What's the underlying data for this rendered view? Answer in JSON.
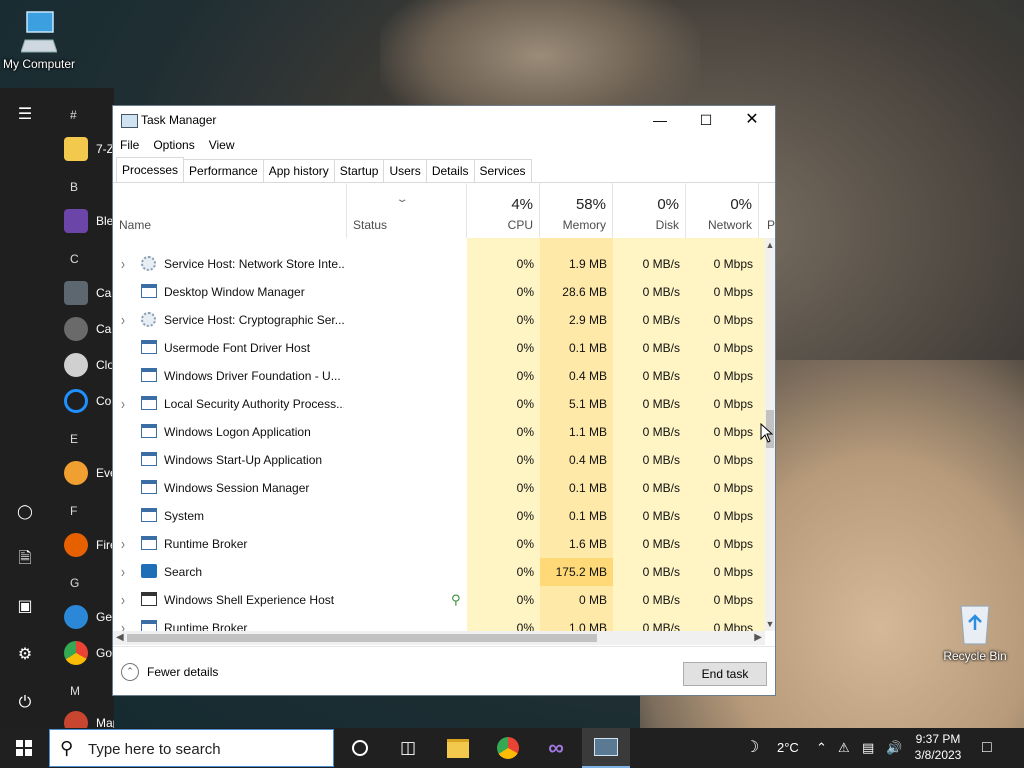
{
  "desktop": {
    "my_computer": "My Computer",
    "recycle_bin": "Recycle Bin"
  },
  "start_menu": {
    "letters": [
      "#",
      "B",
      "C",
      "E",
      "F",
      "G",
      "M"
    ],
    "apps": [
      {
        "label": "7-Z",
        "icon": "folder-icon",
        "color": "#f2c94c"
      },
      {
        "label": "Ble",
        "icon": "blend-icon",
        "color": "#6b45a8"
      },
      {
        "label": "Cal",
        "icon": "calculator-icon",
        "color": "#5c6770"
      },
      {
        "label": "Can",
        "icon": "camera-icon",
        "color": "#6a6a6a"
      },
      {
        "label": "Clo",
        "icon": "clock-icon",
        "color": "#d0d0d0"
      },
      {
        "label": "Co",
        "icon": "cortana-icon",
        "color": "#1e90ff"
      },
      {
        "label": "Eve",
        "icon": "search-tool-icon",
        "color": "#f0a030"
      },
      {
        "label": "Fire",
        "icon": "firefox-icon",
        "color": "#e66000"
      },
      {
        "label": "Ge",
        "icon": "help-icon",
        "color": "#2b88d8"
      },
      {
        "label": "Go",
        "icon": "chrome-icon",
        "color": "#34a853"
      },
      {
        "label": "Maps",
        "icon": "maps-icon",
        "color": "#c84630"
      }
    ]
  },
  "task_manager": {
    "title": "Task Manager",
    "menu": [
      "File",
      "Options",
      "View"
    ],
    "tabs": [
      "Processes",
      "Performance",
      "App history",
      "Startup",
      "Users",
      "Details",
      "Services"
    ],
    "columns": {
      "name": "Name",
      "status": "Status",
      "cpu_pct": "4%",
      "cpu": "CPU",
      "memory_pct": "58%",
      "memory": "Memory",
      "disk_pct": "0%",
      "disk": "Disk",
      "network_pct": "0%",
      "network": "Network",
      "power": "P"
    },
    "rows": [
      {
        "expand": true,
        "icon": "svc",
        "name": "Service Host: Network Store Inte...",
        "cpu": "0%",
        "memory": "1.9 MB",
        "disk": "0 MB/s",
        "network": "0 Mbps"
      },
      {
        "expand": false,
        "icon": "win",
        "name": "Desktop Window Manager",
        "cpu": "0%",
        "memory": "28.6 MB",
        "disk": "0 MB/s",
        "network": "0 Mbps"
      },
      {
        "expand": true,
        "icon": "svc",
        "name": "Service Host: Cryptographic Ser...",
        "cpu": "0%",
        "memory": "2.9 MB",
        "disk": "0 MB/s",
        "network": "0 Mbps"
      },
      {
        "expand": false,
        "icon": "win",
        "name": "Usermode Font Driver Host",
        "cpu": "0%",
        "memory": "0.1 MB",
        "disk": "0 MB/s",
        "network": "0 Mbps"
      },
      {
        "expand": false,
        "icon": "win",
        "name": "Windows Driver Foundation - U...",
        "cpu": "0%",
        "memory": "0.4 MB",
        "disk": "0 MB/s",
        "network": "0 Mbps"
      },
      {
        "expand": true,
        "icon": "win",
        "name": "Local Security Authority Process...",
        "cpu": "0%",
        "memory": "5.1 MB",
        "disk": "0 MB/s",
        "network": "0 Mbps"
      },
      {
        "expand": false,
        "icon": "win",
        "name": "Windows Logon Application",
        "cpu": "0%",
        "memory": "1.1 MB",
        "disk": "0 MB/s",
        "network": "0 Mbps"
      },
      {
        "expand": false,
        "icon": "win",
        "name": "Windows Start-Up Application",
        "cpu": "0%",
        "memory": "0.4 MB",
        "disk": "0 MB/s",
        "network": "0 Mbps"
      },
      {
        "expand": false,
        "icon": "win",
        "name": "Windows Session Manager",
        "cpu": "0%",
        "memory": "0.1 MB",
        "disk": "0 MB/s",
        "network": "0 Mbps"
      },
      {
        "expand": false,
        "icon": "win",
        "name": "System",
        "cpu": "0%",
        "memory": "0.1 MB",
        "disk": "0 MB/s",
        "network": "0 Mbps"
      },
      {
        "expand": true,
        "icon": "win",
        "name": "Runtime Broker",
        "cpu": "0%",
        "memory": "1.6 MB",
        "disk": "0 MB/s",
        "network": "0 Mbps"
      },
      {
        "expand": true,
        "icon": "srch",
        "name": "Search",
        "cpu": "0%",
        "memory": "175.2 MB",
        "disk": "0 MB/s",
        "network": "0 Mbps",
        "highlight": true
      },
      {
        "expand": true,
        "icon": "shell",
        "name": "Windows Shell Experience Host",
        "cpu": "0%",
        "memory": "0 MB",
        "disk": "0 MB/s",
        "network": "0 Mbps",
        "suspended": true
      },
      {
        "expand": true,
        "icon": "win",
        "name": "Runtime Broker",
        "cpu": "0%",
        "memory": "1.0 MB",
        "disk": "0 MB/s",
        "network": "0 Mbps"
      }
    ],
    "fewer_details": "Fewer details",
    "end_task": "End task"
  },
  "taskbar": {
    "search_placeholder": "Type here to search",
    "temperature": "2°C",
    "time": "9:37 PM",
    "date": "3/8/2023"
  },
  "colors": {
    "cpu_bg": "#fff4c4",
    "memory_bg": "#ffe9a8",
    "memory_highlight": "#ffd877",
    "accent": "#7fb3e6"
  }
}
